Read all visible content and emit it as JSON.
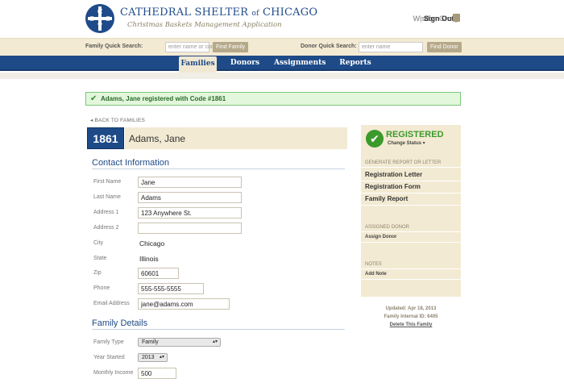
{
  "header": {
    "logo_letters": [
      "C",
      "S",
      "S",
      "T"
    ],
    "title_main": "CATHEDRAL SHELTER",
    "title_of": "of",
    "title_city": "CHICAGO",
    "subtitle": "Christmas Baskets Management Application",
    "user": "WisdomGroup",
    "separator": "|",
    "signout": "Sign Out"
  },
  "search": {
    "family_label": "Family Quick Search:",
    "family_placeholder": "enter name or code",
    "family_button": "Find Family",
    "donor_label": "Donor Quick Search:",
    "donor_placeholder": "enter name",
    "donor_button": "Find Donor"
  },
  "nav": {
    "tabs": [
      {
        "label": "Families",
        "active": true
      },
      {
        "label": "Donors",
        "active": false
      },
      {
        "label": "Assignments",
        "active": false
      },
      {
        "label": "Reports",
        "active": false
      }
    ]
  },
  "flash": {
    "message": "Adams, Jane registered with Code #1861"
  },
  "back_link": "◂ BACK TO FAMILIES",
  "family": {
    "code": "1861",
    "name": "Adams, Jane"
  },
  "contact": {
    "title": "Contact Information",
    "fields": [
      {
        "label": "First Name",
        "value": "Jane"
      },
      {
        "label": "Last Name",
        "value": "Adams"
      },
      {
        "label": "Address 1",
        "value": "123 Anywhere St."
      },
      {
        "label": "Address 2",
        "value": ""
      },
      {
        "label": "City",
        "value": "Chicago"
      },
      {
        "label": "State",
        "value": "Illinois"
      },
      {
        "label": "Zip",
        "value": "60601"
      },
      {
        "label": "Phone",
        "value": "555-555-5555"
      },
      {
        "label": "Email Address",
        "value": "jane@adams.com"
      }
    ]
  },
  "details": {
    "title": "Family Details",
    "fields": [
      {
        "label": "Family Type",
        "value": "Family"
      },
      {
        "label": "Year Started",
        "value": "2013"
      },
      {
        "label": "Monthly Income",
        "value": "500"
      }
    ]
  },
  "status_panel": {
    "status": "REGISTERED",
    "change_status": "Change Status ▾",
    "report_heading": "GENERATE REPORT OR LETTER",
    "reports": [
      "Registration Letter",
      "Registration Form",
      "Family Report"
    ],
    "donor_heading": "ASSIGNED DONOR",
    "assign_donor": "Assign Donor",
    "notes_heading": "NOTES",
    "add_note": "Add Note"
  },
  "meta": {
    "updated": "Updated: Apr 18, 2013",
    "internal_id": "Family Internal ID: 6405",
    "delete": "Delete This Family"
  },
  "colors": {
    "brand_blue": "#1e4a87",
    "tan": "#f3ead3",
    "success_green": "#3c9a2d"
  }
}
